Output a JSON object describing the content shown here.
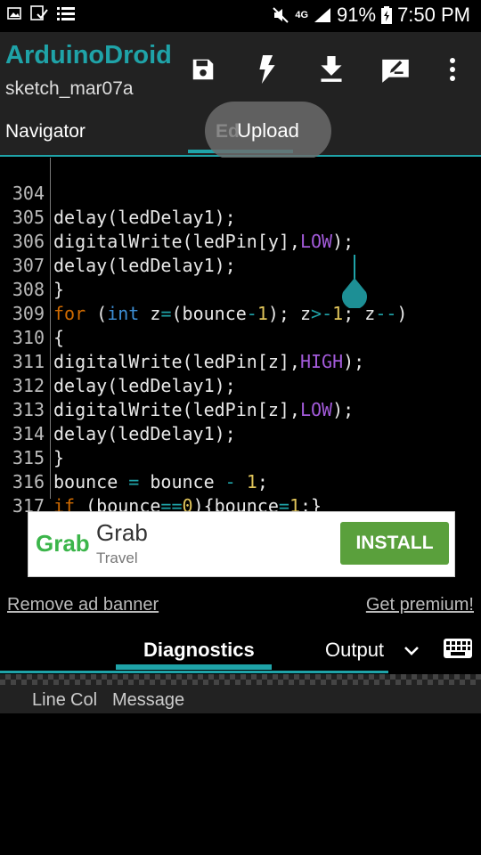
{
  "status_bar": {
    "left_icons": [
      "image-icon",
      "checkbox-icon",
      "list-icon"
    ],
    "right_icons": [
      "mute-icon",
      "4g-icon",
      "signal-icon",
      "battery-icon"
    ],
    "network": "4G",
    "battery": "91%",
    "time": "7:50 PM"
  },
  "app_bar": {
    "title": "ArduinoDroid",
    "subtitle": "sketch_mar07a",
    "actions": [
      "save-icon",
      "flash-icon",
      "download-icon",
      "edit-icon",
      "more-icon"
    ]
  },
  "tabs": {
    "navigator": "Navigator",
    "editor": "Ed"
  },
  "toast": "Upload",
  "code_lines": [
    {
      "num": "304",
      "text": "delay(ledDelay1);"
    },
    {
      "num": "305",
      "text": "digitalWrite(ledPin[y],LOW);"
    },
    {
      "num": "306",
      "text": "delay(ledDelay1);"
    },
    {
      "num": "307",
      "text": "}"
    },
    {
      "num": "308",
      "text": "for (int z=(bounce-1); z>-1; z--)"
    },
    {
      "num": "309",
      "text": "{"
    },
    {
      "num": "310",
      "text": "digitalWrite(ledPin[z],HIGH);"
    },
    {
      "num": "311",
      "text": "delay(ledDelay1);"
    },
    {
      "num": "312",
      "text": "digitalWrite(ledPin[z],LOW);"
    },
    {
      "num": "313",
      "text": "delay(ledDelay1);"
    },
    {
      "num": "314",
      "text": "}"
    },
    {
      "num": "315",
      "text": "bounce = bounce - 1;"
    },
    {
      "num": "316",
      "text": "if (bounce==0){bounce=1;}"
    },
    {
      "num": "317",
      "text": "}"
    }
  ],
  "ad": {
    "logo": "Grab",
    "name": "Grab",
    "category": "Travel",
    "install": "INSTALL"
  },
  "links": {
    "remove_ad": "Remove ad banner",
    "premium": "Get premium!"
  },
  "bottom_tabs": {
    "diagnostics": "Diagnostics",
    "output": "Output"
  },
  "diag_columns": {
    "line": "Line",
    "col": "Col",
    "message": "Message"
  },
  "colors": {
    "accent": "#1fa3a8",
    "keyword": "#cf6a00",
    "type": "#3d8fd6",
    "number": "#e0c45a",
    "constant": "#a25ad9"
  }
}
